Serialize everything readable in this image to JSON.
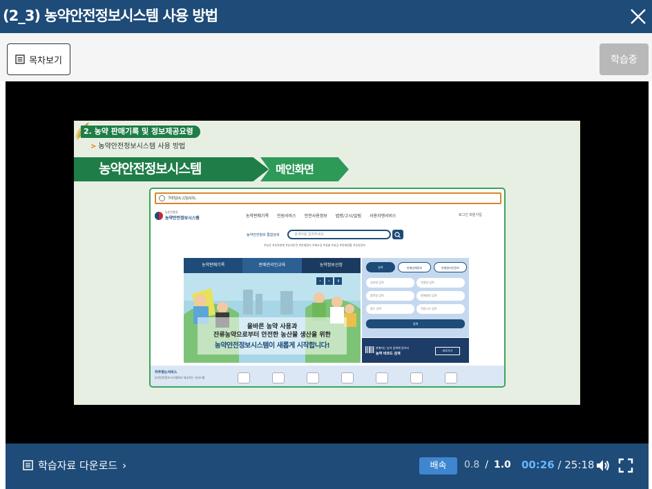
{
  "header": {
    "title": "(2_3) 농약안전정보시스템 사용 방법"
  },
  "toolbar": {
    "toc_label": "목차보기",
    "status_label": "학습중"
  },
  "slide": {
    "section_title": "2. 농약 판매기록 및 정보제공요령",
    "subheading": "농약안전정보시스템 사용 방법",
    "subheading_arrow": ">",
    "banner_main": "농약안전정보시스템",
    "banner_sub": "메인화면",
    "browser": {
      "url": "https://psis.",
      "site_name": "농약안전정보시스템",
      "site_org": "농촌진흥청",
      "nav": [
        "농약판매기록",
        "민원서비스",
        "안전사용정보",
        "법령/고시/알림",
        "서용자맹서비스"
      ],
      "util": "로그인 회원가입",
      "search_label": "농약안전정보 통합검색",
      "search_placeholder": "검색어를 입력하세요",
      "tags": "#농약  #농약판매  #농약안전  #판매관리  #제조업  #살충  #살균  #판매현황  #농약정보",
      "hero_tabs": [
        "농약판매기록",
        "판매관리인교육",
        "농약정보선정"
      ],
      "hero_caption1": "올바른 농약 사용과",
      "hero_caption2": "잔류농약으로부터 안전한 농산물 생산을 위한",
      "hero_caption3": "농약안전정보시스템이 새롭게 시작합니다!",
      "rp_tabs": [
        "농약",
        "판매업체정보",
        "판매관리인정보"
      ],
      "rp_fields": [
        "상표명 입력",
        "작물명 입력",
        "품목명 입력",
        "병해충명 입력",
        "용도 선택",
        "적용시기 입력"
      ],
      "rp_button": "검색",
      "barcode_title": "판매자는 농약 검색에 있어서",
      "barcode_main": "농약 바코드 검색",
      "barcode_button": "바로가기",
      "freq_label": "자주찾는서비스",
      "freq_desc": "농약안전정보시스템에서 제공하는 서비스를"
    }
  },
  "controls": {
    "download_label": "학습자료 다운로드",
    "download_chevron": "›",
    "speed_label": "배속",
    "speed_current": "0.8",
    "speed_separator": "/",
    "speed_max": "1.0",
    "time_current": "00:26",
    "time_separator": "/",
    "time_total": "25:18"
  },
  "colors": {
    "header_bg": "#1e4b78",
    "accent_green": "#1f7d48",
    "speed_button": "#3f86d0",
    "time_current": "#67b6ff"
  },
  "icons": {
    "close": "close-icon",
    "toc": "list-icon",
    "download": "list-icon",
    "volume": "volume-icon",
    "fullscreen": "fullscreen-icon"
  }
}
